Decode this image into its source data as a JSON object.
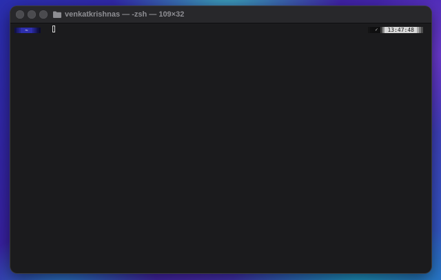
{
  "window": {
    "title": "venkatkrishnas — -zsh — 109×32"
  },
  "icons": {
    "folder": "folder-icon",
    "check": "checkmark-icon"
  },
  "prompt": {
    "directory": "~",
    "status_symbol": "✓",
    "time": "13:47:48"
  },
  "colors": {
    "terminal_background": "#1b1b1d",
    "prompt_directory_bg": "#2e2fae",
    "clock_bg": "#d9d9d9"
  }
}
